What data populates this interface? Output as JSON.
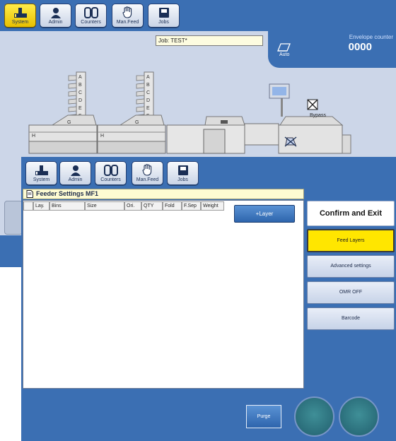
{
  "toolbar": {
    "buttons": [
      {
        "label": "System",
        "icon": "system-icon",
        "active": true
      },
      {
        "label": "Admin",
        "icon": "admin-icon"
      },
      {
        "label": "Counters",
        "icon": "counters-icon"
      },
      {
        "label": "Man.Feed",
        "icon": "hand-icon"
      },
      {
        "label": "Jobs",
        "icon": "jobs-icon"
      }
    ]
  },
  "status": {
    "job": "Job: TEST*",
    "envelope_counter_label": "Envelope counter",
    "envelope_counter_value": "0000",
    "mode": "Auto"
  },
  "machine": {
    "feeder_labels": [
      "A",
      "B",
      "C",
      "D",
      "E",
      "F"
    ],
    "station_g": "G",
    "station_h": "H",
    "bypass_label": "Bypass"
  },
  "feeder_settings": {
    "title": "Feeder Settings MF1",
    "columns": [
      "",
      "Lay.",
      "Bins",
      "Size",
      "Ori.",
      "QTY",
      "Fold",
      "F.Sep",
      "Weight"
    ],
    "add_layer_label": "+Layer"
  },
  "side_panel": {
    "confirm_exit": "Confirm and Exit",
    "feed_layers": "Feed Layers",
    "advanced_settings": "Advanced settings",
    "omr": "OMR OFF",
    "barcode": "Barcode"
  },
  "footer": {
    "purge": "Purge"
  },
  "colors": {
    "toolbar_blue": "#3b6fb3",
    "active_yellow": "#ffe600",
    "background": "#ccd6e8"
  }
}
